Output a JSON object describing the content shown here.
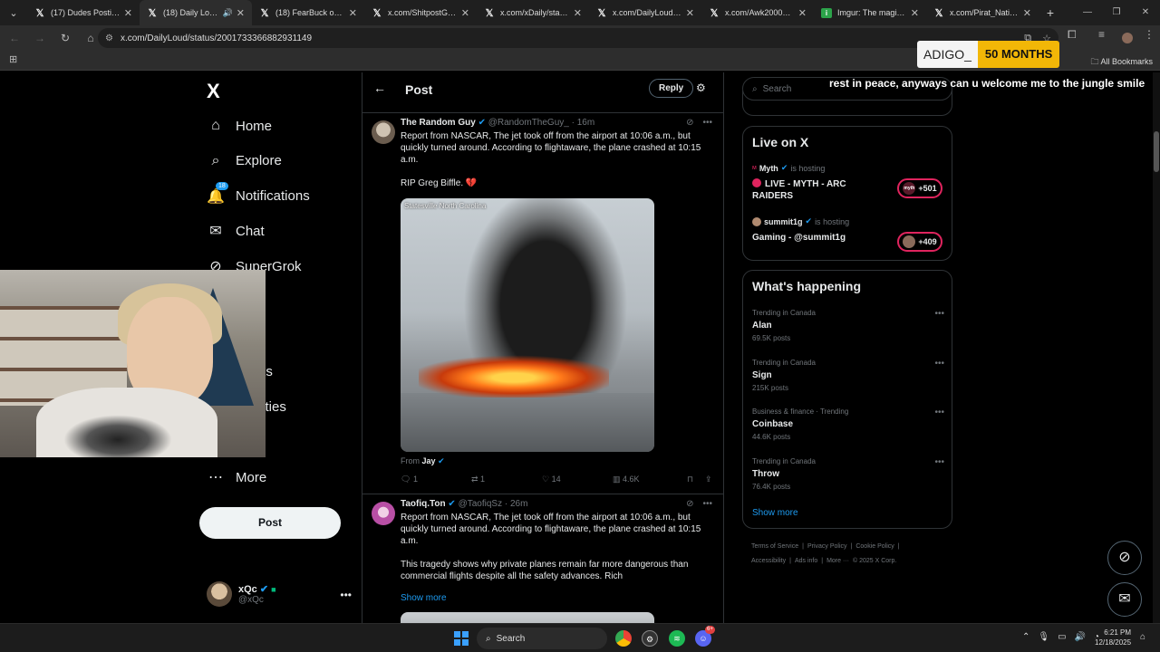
{
  "browser": {
    "tabs": [
      {
        "favicon": "X",
        "label": "(17) Dudes Posting Th",
        "active": false
      },
      {
        "favicon": "X",
        "label": "(18) Daily Loud o",
        "active": true,
        "audio": true
      },
      {
        "favicon": "X",
        "label": "(18) FearBuck on X: \"",
        "active": false
      },
      {
        "favicon": "X",
        "label": "x.com/ShitpostGate/s",
        "active": false
      },
      {
        "favicon": "X",
        "label": "x.com/xDaily/status/2",
        "active": false
      },
      {
        "favicon": "X",
        "label": "x.com/DailyLoud/sta",
        "active": false
      },
      {
        "favicon": "X",
        "label": "x.com/Awk20000/stat",
        "active": false
      },
      {
        "favicon": "imgur",
        "label": "Imgur: The magic of t",
        "active": false
      },
      {
        "favicon": "X",
        "label": "x.com/Pirat_Nation/s",
        "active": false
      }
    ],
    "url": "x.com/DailyLoud/status/2001733366882931149",
    "bookmarks_label": "All Bookmarks"
  },
  "overlay": {
    "sub_name": "ADIGO_",
    "sub_months": "50 MONTHS",
    "caption": "rest in peace, anyways can u welcome me to the jungle smile"
  },
  "nav": {
    "logo": "X",
    "items": [
      {
        "label": "Home",
        "icon": "home-icon"
      },
      {
        "label": "Explore",
        "icon": "search-icon"
      },
      {
        "label": "Notifications",
        "icon": "bell-icon",
        "badge": "18"
      },
      {
        "label": "Chat",
        "icon": "mail-icon"
      },
      {
        "label": "SuperGrok",
        "icon": "grok-icon"
      },
      {
        "label": "ium",
        "icon": "premium-icon"
      },
      {
        "label": "",
        "icon": "lists-icon"
      },
      {
        "label": "marks",
        "icon": "bookmark-icon"
      },
      {
        "label": "munities",
        "icon": "communities-icon"
      },
      {
        "label": "e",
        "icon": "profile-icon"
      },
      {
        "label": "More",
        "icon": "more-icon"
      }
    ],
    "post_button": "Post",
    "profile": {
      "name": "xQc",
      "handle": "@xQc"
    }
  },
  "thread": {
    "title": "Post",
    "reply_button": "Reply",
    "posts": [
      {
        "author": "The Random Guy",
        "handle": "@RandomTheGuy_",
        "time": "16m",
        "text_lines": [
          "Report from NASCAR, The jet took off from the airport at 10:06 a.m., but",
          "quickly turned around. According to flightaware, the plane crashed at 10:15",
          "a.m."
        ],
        "text_extra": "RIP Greg Biffle. 💔",
        "media_location": "Statesville North Carolina",
        "from_prefix": "From",
        "from_name": "Jay",
        "stats": {
          "replies": "1",
          "reposts": "1",
          "likes": "14",
          "views": "4.6K"
        }
      },
      {
        "author": "Taofiq.Ton",
        "handle": "@TaofiqSz",
        "time": "26m",
        "text_lines": [
          "Report from NASCAR, The jet took off from the airport at 10:06 a.m., but",
          "quickly turned around. According to flightaware, the plane crashed at 10:15",
          "a.m."
        ],
        "text_extra_lines": [
          "This tragedy shows why private planes remain far more dangerous than",
          "commercial flights despite all the safety advances. Rich"
        ],
        "show_more": "Show more"
      }
    ]
  },
  "sidebar": {
    "search_placeholder": "Search",
    "live": {
      "title": "Live on X",
      "streams": [
        {
          "host": "Myth",
          "hosting_label": "is hosting",
          "title_lines": [
            "LIVE - MYTH - ARC",
            "RAIDERS"
          ],
          "count": "+501",
          "pill_avatar": "myth"
        },
        {
          "host": "summit1g",
          "hosting_label": "is hosting",
          "title_lines": [
            "Gaming - @summit1g"
          ],
          "count": "+409",
          "pill_avatar": ""
        }
      ]
    },
    "happening": {
      "title": "What's happening",
      "trends": [
        {
          "context": "Trending in Canada",
          "name": "Alan",
          "posts": "69.5K posts"
        },
        {
          "context": "Trending in Canada",
          "name": "Sign",
          "posts": "215K posts"
        },
        {
          "context": "Business & finance · Trending",
          "name": "Coinbase",
          "posts": "44.6K posts"
        },
        {
          "context": "Trending in Canada",
          "name": "Throw",
          "posts": "76.4K posts"
        }
      ],
      "show_more": "Show more"
    },
    "footer_line1": [
      "Terms of Service",
      "|",
      "Privacy Policy",
      "|",
      "Cookie Policy",
      "|"
    ],
    "footer_line2": [
      "Accessibility",
      "|",
      "Ads info",
      "|",
      "More ···",
      "© 2025 X Corp."
    ]
  },
  "taskbar": {
    "search_label": "Search",
    "time": "6:21 PM",
    "date": "12/18/2025",
    "discord_badge": "6+"
  }
}
